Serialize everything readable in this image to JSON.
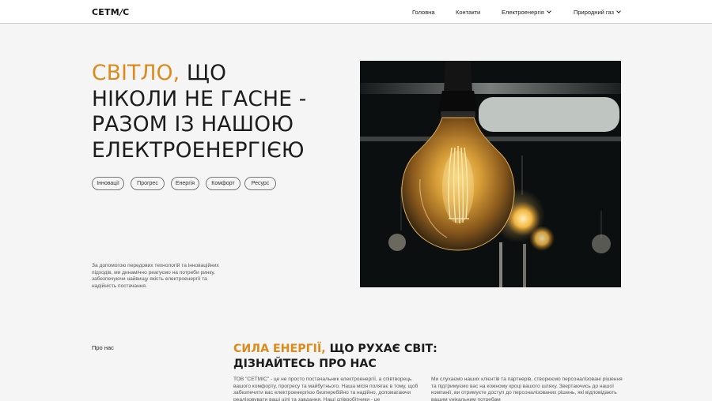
{
  "header": {
    "logo_text": "CETM",
    "logo_slash": "/",
    "logo_end": "C",
    "nav": [
      {
        "label": "Головна",
        "dropdown": false
      },
      {
        "label": "Контакти",
        "dropdown": false
      },
      {
        "label": "Електроенергія",
        "dropdown": true
      },
      {
        "label": "Природний газ",
        "dropdown": true
      }
    ]
  },
  "hero": {
    "title_accent": "СВІТЛО,",
    "title_line1_rest": " ЩО",
    "title_line2": "НІКОЛИ НЕ ГАСНЕ -",
    "title_line3": "РАЗОМ ІЗ НАШОЮ",
    "title_line4": "ЕЛЕКТРОЕНЕРГІЄЮ",
    "tags": [
      "Інновації",
      "Прогрес",
      "Енергія",
      "Комфорт",
      "Ресурс"
    ],
    "description": "За допомогою передових технологій та інноваційних підходів, ми динамічно реагуємо на потреби ринку, забезпечуючи найвищу якість електроенергії та надійність постачання.",
    "image_subject": "glowing filament light bulb on dark background"
  },
  "about": {
    "label": "Про нас",
    "title_accent": "СИЛА ЕНЕРГІЇ,",
    "title_rest_line1": " ЩО РУХАЄ СВІТ:",
    "title_line2": "ДІЗНАЙТЕСЬ ПРО НАС",
    "col1": "ТОВ \"СЕТМІС\" - це не просто постачальник електроенергії, а співтворець вашого комфорту, прогресу та майбутнього. Наша місія полягає в тому, щоб забезпечити вас електроенергією безперебійно та надійно, допомагаючи реалізовувати ваші цілі та завдання. Наші співробітники - це",
    "col2": "Ми слухаємо наших клієнтів та партнерів, створюємо персоналізовані рішення та підтримуємо вас на кожному кроці вашого шляху. Звертаючись до нашої компанії, ви отримуєте доступ до персоналізованих рішень, які відповідають вашим унікальним потребам"
  },
  "colors": {
    "accent": "#dc8b1b",
    "background": "#f5f5f5",
    "header_bg": "#ffffff",
    "text": "#1c1c1c"
  },
  "icons": [
    "chevron-down-icon"
  ]
}
